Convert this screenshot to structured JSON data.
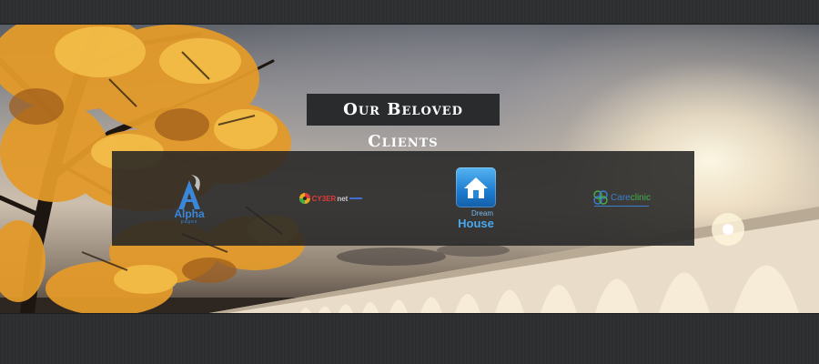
{
  "section": {
    "title": "Our Beloved Clients"
  },
  "clients": [
    {
      "name_main": "Alpha",
      "name_sub": "pages",
      "icon": "alpha-a-logo"
    },
    {
      "name_main": "CY3ER",
      "name_sub": "net",
      "icon": "cyber-globe-logo"
    },
    {
      "name_line1": "Dream",
      "name_line2": "House",
      "icon": "house-app-logo"
    },
    {
      "name_part1": "Care",
      "name_part2": "clinic",
      "icon": "clover-logo"
    }
  ],
  "colors": {
    "panel": "#262626",
    "title_bg": "#2a2b2c",
    "alpha_blue": "#3a86d8",
    "cyber_red": "#e23b3b",
    "dream_blue": "#4aa8f0",
    "care_green": "#45b04c"
  }
}
